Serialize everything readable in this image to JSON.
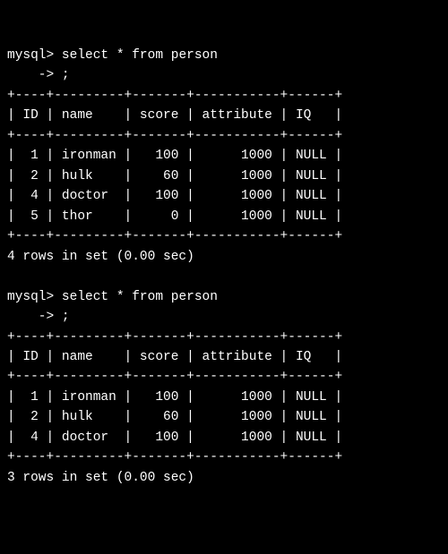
{
  "prompt_label": "mysql>",
  "continuation_label": "    ->",
  "queries": [
    {
      "sql_line1": " select * from person",
      "sql_line2": " ;",
      "separator": "+----+---------+-------+-----------+------+",
      "header": "| ID | name    | score | attribute | IQ   |",
      "rows": [
        "|  1 | ironman |   100 |      1000 | NULL |",
        "|  2 | hulk    |    60 |      1000 | NULL |",
        "|  4 | doctor  |   100 |      1000 | NULL |",
        "|  5 | thor    |     0 |      1000 | NULL |"
      ],
      "footer": "4 rows in set (0.00 sec)"
    },
    {
      "sql_line1": " select * from person",
      "sql_line2": " ;",
      "separator": "+----+---------+-------+-----------+------+",
      "header": "| ID | name    | score | attribute | IQ   |",
      "rows": [
        "|  1 | ironman |   100 |      1000 | NULL |",
        "|  2 | hulk    |    60 |      1000 | NULL |",
        "|  4 | doctor  |   100 |      1000 | NULL |"
      ],
      "footer": "3 rows in set (0.00 sec)"
    }
  ],
  "chart_data": [
    {
      "type": "table",
      "title": "person (query 1)",
      "columns": [
        "ID",
        "name",
        "score",
        "attribute",
        "IQ"
      ],
      "rows": [
        [
          1,
          "ironman",
          100,
          1000,
          null
        ],
        [
          2,
          "hulk",
          60,
          1000,
          null
        ],
        [
          4,
          "doctor",
          100,
          1000,
          null
        ],
        [
          5,
          "thor",
          0,
          1000,
          null
        ]
      ],
      "footer": "4 rows in set (0.00 sec)"
    },
    {
      "type": "table",
      "title": "person (query 2)",
      "columns": [
        "ID",
        "name",
        "score",
        "attribute",
        "IQ"
      ],
      "rows": [
        [
          1,
          "ironman",
          100,
          1000,
          null
        ],
        [
          2,
          "hulk",
          60,
          1000,
          null
        ],
        [
          4,
          "doctor",
          100,
          1000,
          null
        ]
      ],
      "footer": "3 rows in set (0.00 sec)"
    }
  ]
}
